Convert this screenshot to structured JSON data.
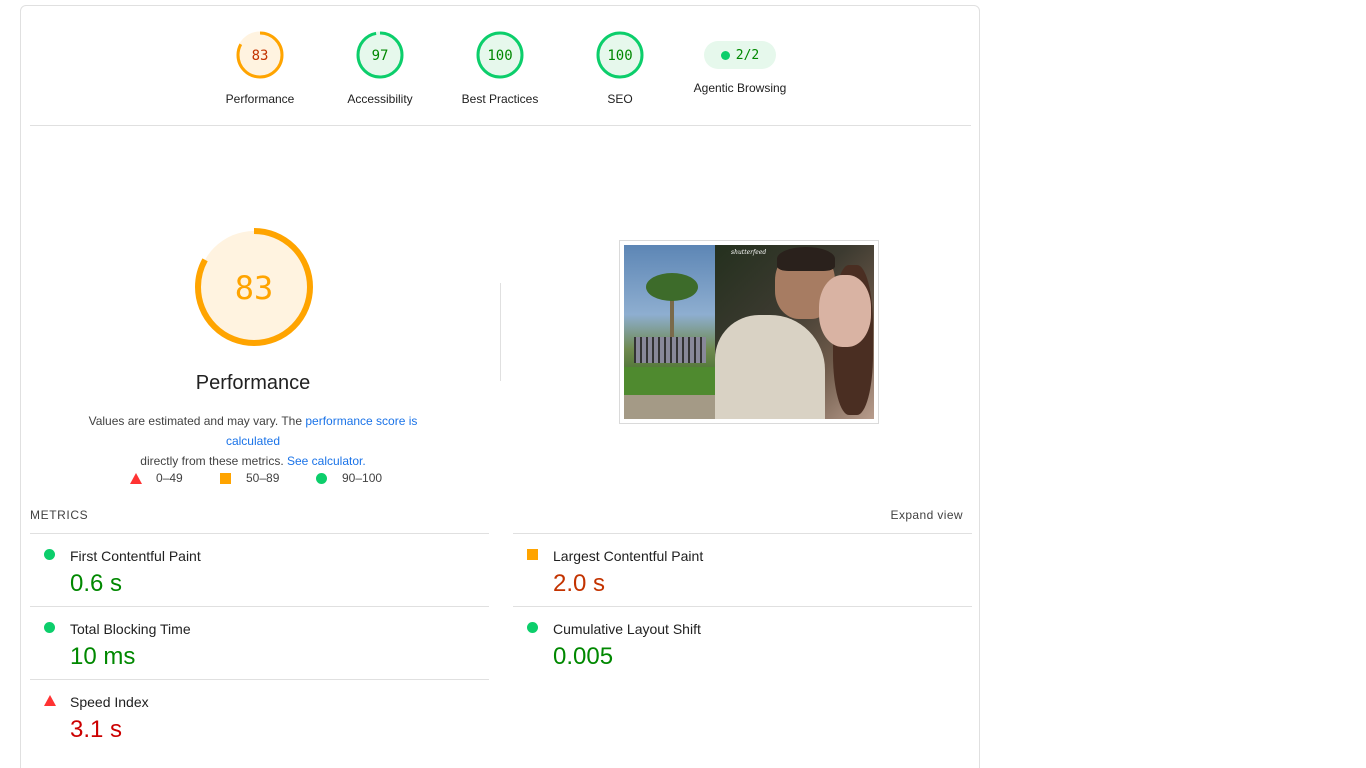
{
  "gauges": [
    {
      "score": "83",
      "label": "Performance",
      "color": "#ffa400",
      "text_color": "#c33300",
      "fill": "#fff3e0",
      "fraction": 0.83
    },
    {
      "score": "97",
      "label": "Accessibility",
      "color": "#0cce6b",
      "text_color": "#008800",
      "fill": "#e6f8ec",
      "fraction": 0.97
    },
    {
      "score": "100",
      "label": "Best Practices",
      "color": "#0cce6b",
      "text_color": "#008800",
      "fill": "#e6f8ec",
      "fraction": 1.0
    },
    {
      "score": "100",
      "label": "SEO",
      "color": "#0cce6b",
      "text_color": "#008800",
      "fill": "#e6f8ec",
      "fraction": 1.0
    }
  ],
  "agentic": {
    "value": "2/2",
    "label": "Agentic Browsing"
  },
  "performance": {
    "score": "83",
    "fraction": 0.83,
    "title": "Performance",
    "desc_prefix": "Values are estimated and may vary. The ",
    "desc_link1": "performance score is calculated",
    "desc_middle": "directly from these metrics. ",
    "desc_link2": "See calculator.",
    "legend": [
      "0–49",
      "50–89",
      "90–100"
    ]
  },
  "thumbnail": {
    "logo_text": "shutterfeed"
  },
  "metrics": {
    "title": "METRICS",
    "expand_label": "Expand view",
    "items": [
      {
        "name": "First Contentful Paint",
        "value": "0.6 s",
        "status": "pass"
      },
      {
        "name": "Largest Contentful Paint",
        "value": "2.0 s",
        "status": "average"
      },
      {
        "name": "Total Blocking Time",
        "value": "10 ms",
        "status": "pass"
      },
      {
        "name": "Cumulative Layout Shift",
        "value": "0.005",
        "status": "pass"
      },
      {
        "name": "Speed Index",
        "value": "3.1 s",
        "status": "fail"
      }
    ]
  },
  "colors": {
    "pass": "#0cce6b",
    "average": "#ffa400",
    "fail": "#ff3333",
    "link": "#1a73e8"
  }
}
